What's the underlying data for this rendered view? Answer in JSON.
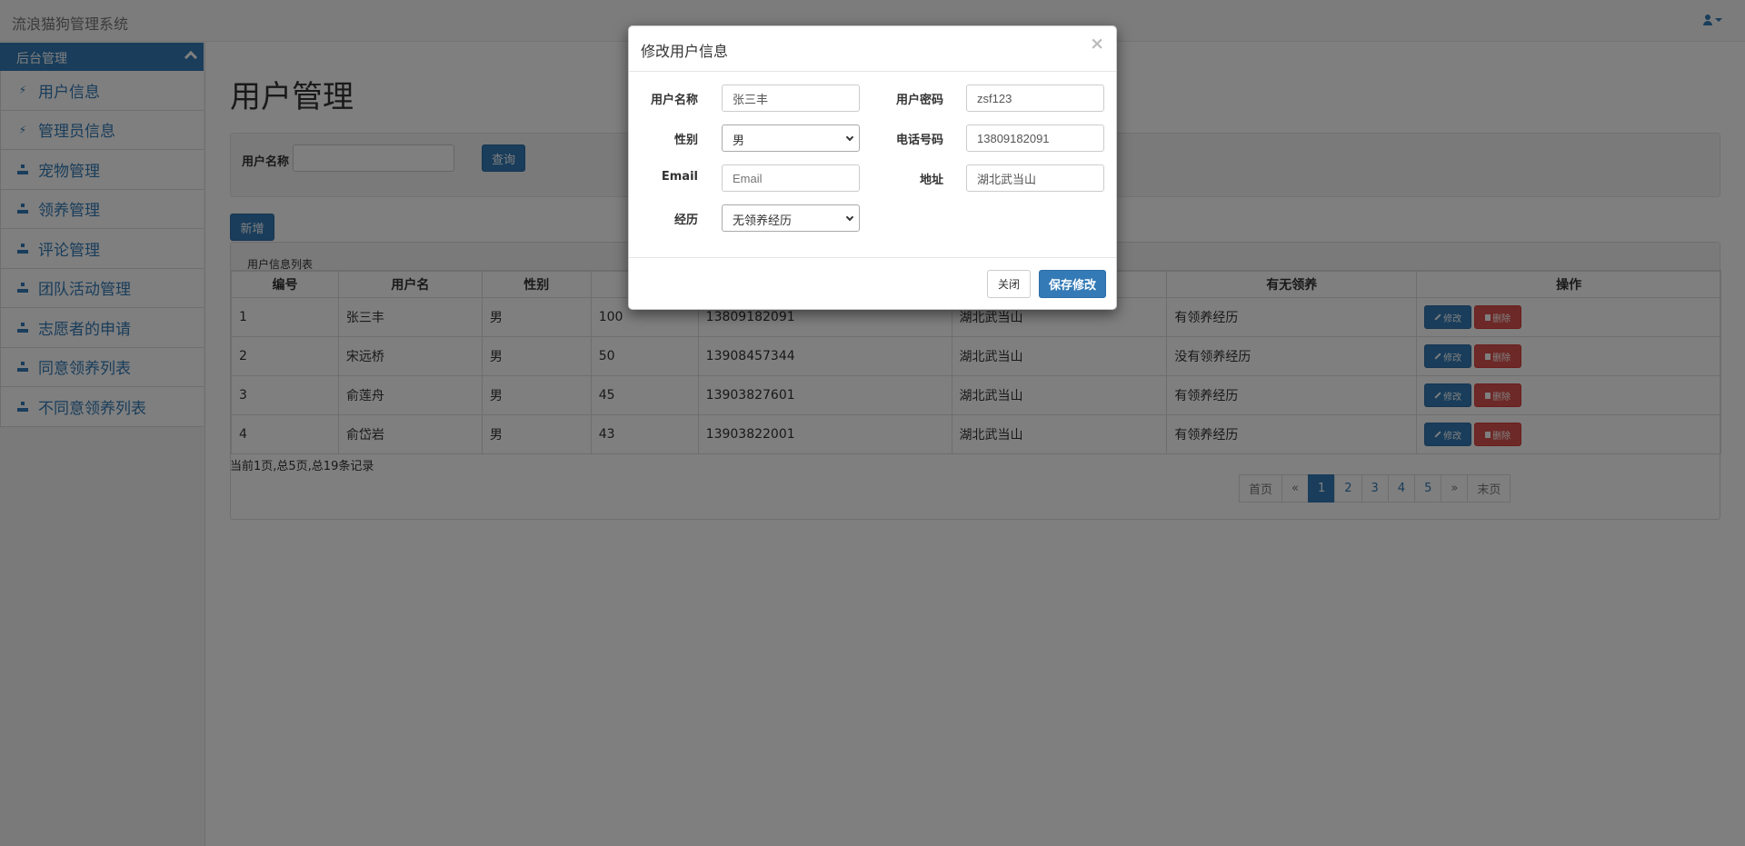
{
  "app": {
    "title": "流浪猫狗管理系统"
  },
  "sidebar": {
    "header": "后台管理",
    "items": [
      {
        "label": "用户信息",
        "icon": "bolt-icon"
      },
      {
        "label": "管理员信息",
        "icon": "bolt-icon"
      },
      {
        "label": "宠物管理",
        "icon": "sitemap-icon"
      },
      {
        "label": "领养管理",
        "icon": "sitemap-icon"
      },
      {
        "label": "评论管理",
        "icon": "sitemap-icon"
      },
      {
        "label": "团队活动管理",
        "icon": "sitemap-icon"
      },
      {
        "label": "志愿者的申请",
        "icon": "sitemap-icon"
      },
      {
        "label": "同意领养列表",
        "icon": "sitemap-icon"
      },
      {
        "label": "不同意领养列表",
        "icon": "sitemap-icon"
      }
    ]
  },
  "main": {
    "page_title": "用户管理",
    "search": {
      "label": "用户名称",
      "value": "",
      "button": "查询"
    },
    "add_button": "新增",
    "panel_title": "用户信息列表",
    "columns": [
      "编号",
      "用户名",
      "性别",
      "",
      "",
      "",
      "有无领养",
      "操作"
    ],
    "rows": [
      [
        "1",
        "张三丰",
        "男",
        "100",
        "13809182091",
        "湖北武当山",
        "有领养经历"
      ],
      [
        "2",
        "宋远桥",
        "男",
        "50",
        "13908457344",
        "湖北武当山",
        "没有领养经历"
      ],
      [
        "3",
        "俞莲舟",
        "男",
        "45",
        "13903827601",
        "湖北武当山",
        "有领养经历"
      ],
      [
        "4",
        "俞岱岩",
        "男",
        "43",
        "13903822001",
        "湖北武当山",
        "有领养经历"
      ]
    ],
    "row_actions": {
      "edit": "修改",
      "delete": "删除"
    },
    "page_info": "当前1页,总5页,总19条记录",
    "pagination": [
      "首页",
      "«",
      "1",
      "2",
      "3",
      "4",
      "5",
      "»",
      "末页"
    ]
  },
  "modal": {
    "title": "修改用户信息",
    "close_symbol": "×",
    "fields": {
      "username_label": "用户名称",
      "username_value": "张三丰",
      "password_label": "用户密码",
      "password_value": "zsf123",
      "gender_label": "性别",
      "gender_value": "男",
      "phone_label": "电话号码",
      "phone_value": "13809182091",
      "email_label": "Email",
      "email_placeholder": "Email",
      "address_label": "地址",
      "address_value": "湖北武当山",
      "experience_label": "经历",
      "experience_value": "无领养经历"
    },
    "close_button": "关闭",
    "save_button": "保存修改"
  },
  "colors": {
    "primary": "#337ab7",
    "danger": "#d9534f",
    "overlay": "rgba(0,0,0,0.5)"
  }
}
